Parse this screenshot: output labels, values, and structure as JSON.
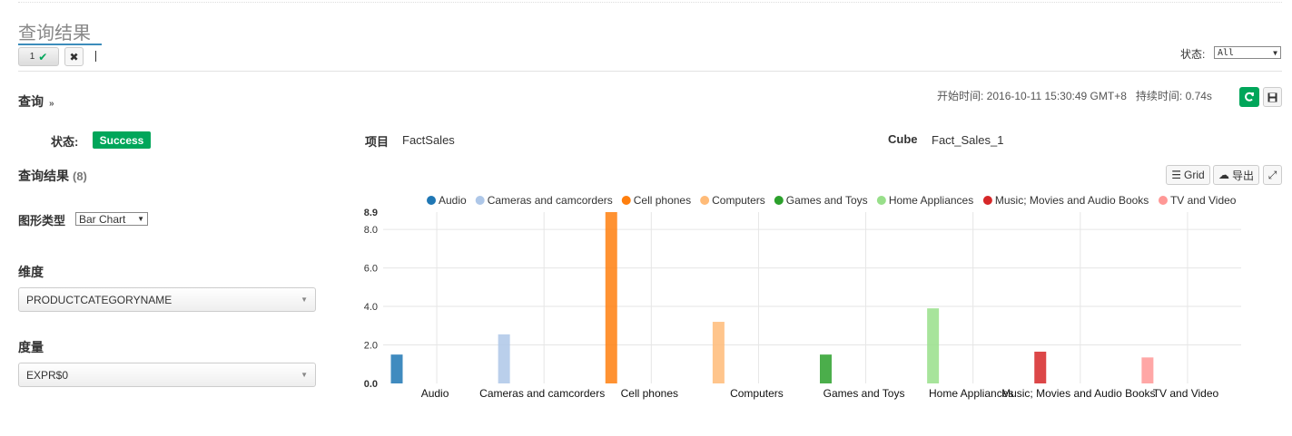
{
  "page": {
    "title": "查询结果",
    "tab_number": "1",
    "status_filter_label": "状态:",
    "status_filter_value": "All"
  },
  "query": {
    "section_title": "查询",
    "start_time": "开始时间: 2016-10-11 15:30:49 GMT+8",
    "duration": "持续时间: 0.74s",
    "status_label": "状态:",
    "status_value": "Success",
    "project_label": "项目",
    "project_value": "FactSales",
    "cube_label": "Cube",
    "cube_value": "Fact_Sales_1"
  },
  "results": {
    "title": "查询结果",
    "count": "(8)",
    "grid_button": "Grid",
    "export_button": "导出",
    "chart_type_label": "图形类型",
    "chart_type_value": "Bar Chart",
    "dimension_label": "维度",
    "dimension_value": "PRODUCTCATEGORYNAME",
    "measure_label": "度量",
    "measure_value": "EXPR$0"
  },
  "colors": {
    "accent_green": "#00a65a",
    "title_underline": "#3c8dbc"
  },
  "chart_data": {
    "type": "bar",
    "categories": [
      "Audio",
      "Cameras and camcorders",
      "Cell phones",
      "Computers",
      "Games and Toys",
      "Home Appliances",
      "Music; Movies and Audio Books",
      "TV and Video"
    ],
    "values": [
      1.5,
      2.55,
      8.9,
      3.2,
      1.5,
      3.9,
      1.65,
      1.35
    ],
    "colors": [
      "#1f77b4",
      "#aec7e8",
      "#ff7f0e",
      "#ffbb78",
      "#2ca02c",
      "#98df8a",
      "#d62728",
      "#ff9896"
    ],
    "ylim": [
      0,
      8.9
    ],
    "yticks": [
      "0.0",
      "2.0",
      "4.0",
      "6.0",
      "8.0",
      "8.9"
    ],
    "grid": true,
    "legend": "top"
  }
}
